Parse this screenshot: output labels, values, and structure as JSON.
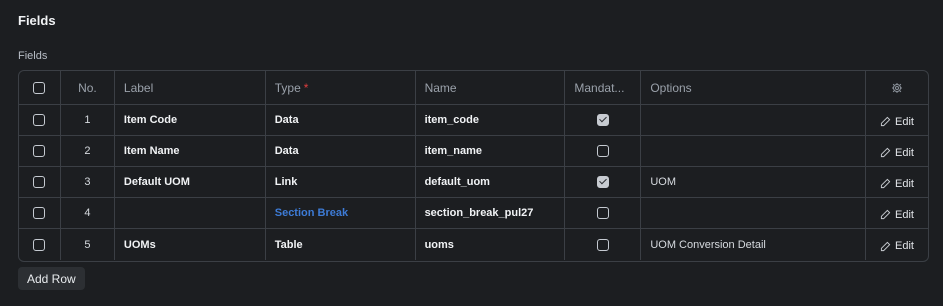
{
  "section": {
    "title": "Fields"
  },
  "table": {
    "caption": "Fields",
    "columns": {
      "no": "No.",
      "label": "Label",
      "type": "Type",
      "type_required_mark": "*",
      "name": "Name",
      "mandatory": "Mandat...",
      "options": "Options"
    },
    "edit_label": "Edit",
    "rows": [
      {
        "no": "1",
        "label": "Item Code",
        "type": "Data",
        "name": "item_code",
        "mandatory": true,
        "options": ""
      },
      {
        "no": "2",
        "label": "Item Name",
        "type": "Data",
        "name": "item_name",
        "mandatory": false,
        "options": ""
      },
      {
        "no": "3",
        "label": "Default UOM",
        "type": "Link",
        "name": "default_uom",
        "mandatory": true,
        "options": "UOM"
      },
      {
        "no": "4",
        "label": "",
        "type": "Section Break",
        "name": "section_break_pul27",
        "mandatory": false,
        "options": ""
      },
      {
        "no": "5",
        "label": "UOMs",
        "type": "Table",
        "name": "uoms",
        "mandatory": false,
        "options": "UOM Conversion Detail"
      }
    ]
  },
  "add_row_label": "Add Row",
  "colors": {
    "link": "#3d7bd6",
    "required": "#e03e3e",
    "background": "#1c1e21"
  }
}
